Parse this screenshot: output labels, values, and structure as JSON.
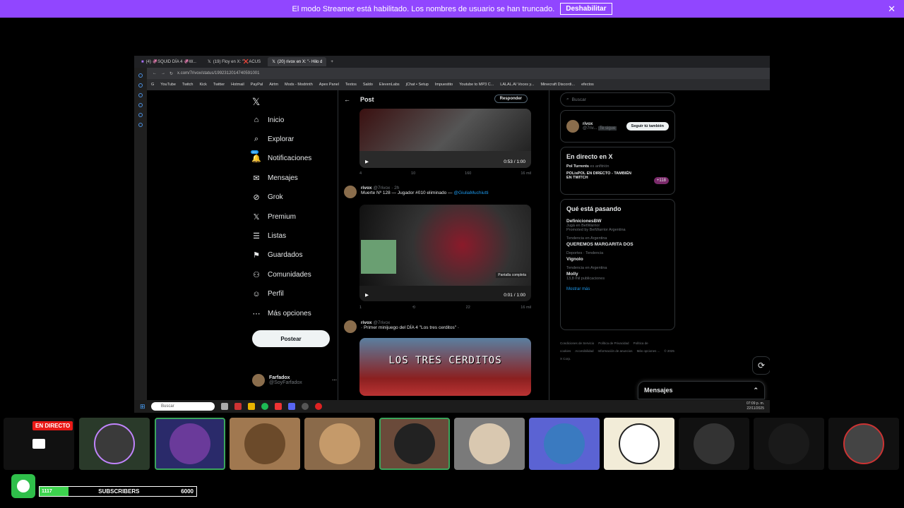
{
  "banner": {
    "text": "El modo Streamer está habilitado. Los nombres de usuario se han truncado.",
    "button": "Deshabilitar",
    "close": "✕"
  },
  "browser": {
    "tabs": [
      {
        "label": "(4) 🦑SQUID DÍA 4 🦑W..."
      },
      {
        "label": "(19) Floy en X: \"❌ACUS"
      },
      {
        "label": "(20) rivox en X: \"- Hilo d"
      }
    ],
    "new_tab": "+",
    "url": "x.com/7rivox/status/1992312014740591001",
    "bookmarks": [
      "G",
      "YouTube",
      "Twitch",
      "Kick",
      "Twitter",
      "Hotmail",
      "PayPal",
      "Airtm",
      "Mods - Modrinth",
      "Apex Panel",
      "Textos",
      "Saldo",
      "ElevenLabs",
      "jChat • Setup",
      "Impuestito",
      "Youtube to MP3 C...",
      "LALAL.AI Voces y...",
      "Minecraft Discordi...",
      "efectos"
    ]
  },
  "xnav": {
    "logo": "𝕏",
    "items": [
      {
        "label": "Inicio",
        "icon": "home-icon",
        "glyph": "⌂"
      },
      {
        "label": "Explorar",
        "icon": "search-icon",
        "glyph": "⌕"
      },
      {
        "label": "Notificaciones",
        "icon": "bell-icon",
        "glyph": "🔔",
        "badge": "20+"
      },
      {
        "label": "Mensajes",
        "icon": "mail-icon",
        "glyph": "✉"
      },
      {
        "label": "Grok",
        "icon": "grok-icon",
        "glyph": "⊘"
      },
      {
        "label": "Premium",
        "icon": "x-premium-icon",
        "glyph": "𝕏"
      },
      {
        "label": "Listas",
        "icon": "list-icon",
        "glyph": "☰"
      },
      {
        "label": "Guardados",
        "icon": "bookmark-icon",
        "glyph": "⚑"
      },
      {
        "label": "Comunidades",
        "icon": "people-icon",
        "glyph": "⚇"
      },
      {
        "label": "Perfil",
        "icon": "user-icon",
        "glyph": "☺"
      },
      {
        "label": "Más opciones",
        "icon": "more-icon",
        "glyph": "⋯"
      }
    ],
    "post_button": "Postear",
    "profile": {
      "name": "Farfadox",
      "handle": "@SoyFarfadox"
    }
  },
  "timeline": {
    "title": "Post",
    "reply_button": "Responder",
    "tweets": [
      {
        "video_time": "0:53 / 1:00",
        "stats": {
          "replies": "4",
          "retweets": "10",
          "likes": "160",
          "views": "16 mil"
        }
      },
      {
        "author": "rivox",
        "handle": "@7rivox · 2h",
        "text": "Muerte Nº 128 — Jugador #010 eliminado —",
        "mention": "@GiuliaMuchiutti",
        "badge": "Pantalla completa",
        "video_time": "0:01 / 1:00",
        "stats": {
          "replies": "1",
          "retweets": "",
          "likes": "22",
          "views": "16 mil"
        }
      },
      {
        "author": "rivox",
        "handle": "@7rivox",
        "text": "· Primer minijuego del DÍA 4 \"Los tres cerditos\" ·",
        "image_text": "LOS TRES CERDITOS"
      }
    ]
  },
  "rightcol": {
    "search_placeholder": "Buscar",
    "follow": {
      "name": "rivox",
      "handle": "@7riv...",
      "tag": "Te sigue",
      "button": "Seguir tú también"
    },
    "live_title": "En directo en X",
    "live": {
      "host": "Pol Turrents",
      "suffix": "es anfitrión",
      "title": "POLisPOL EN DIRECTO - TAMBIÉN EN TWITCH",
      "count": "+118"
    },
    "trends_title": "Qué está pasando",
    "trends": [
      {
        "meta": "",
        "name": "DefinicionesBW",
        "sub": "Jugá en BetWarrior",
        "extra": "Promoted by BetWarrior Argentina"
      },
      {
        "meta": "Tendencia en Argentina",
        "name": "QUEREMOS MARGARITA DOS",
        "sub": "",
        "extra": ""
      },
      {
        "meta": "Deportes · Tendencia",
        "name": "Vignolo",
        "sub": "",
        "extra": ""
      },
      {
        "meta": "Tendencia en Argentina",
        "name": "Molly",
        "sub": "13,8 mil publicaciones",
        "extra": ""
      }
    ],
    "show_more": "Mostrar más",
    "footer": [
      "Condiciones de Servicio",
      "Política de Privacidad",
      "Política de cookies",
      "Accesibilidad",
      "Información de anuncios",
      "Más opciones ...",
      "© 2025 X Corp."
    ],
    "messages": "Mensajes"
  },
  "taskbar": {
    "search": "Buscar",
    "lang": "ESP\nLAA",
    "time": "07:09 p. m.",
    "date": "22/11/2025"
  },
  "stream": {
    "live_badge": "EN DIRECTO",
    "subs_current": "1117",
    "subs_label": "SUBSCRIBERS",
    "subs_goal": "6000",
    "subs_progress": 0.186
  }
}
